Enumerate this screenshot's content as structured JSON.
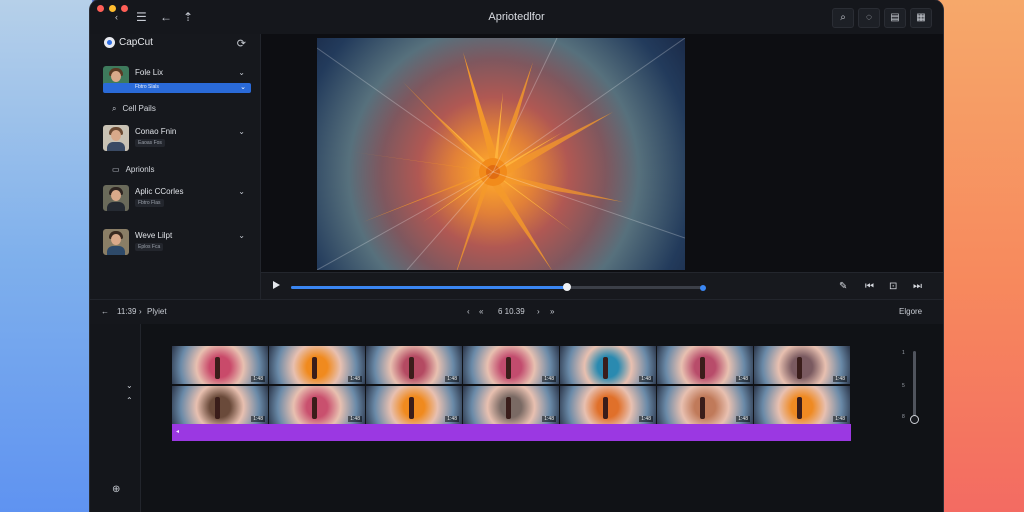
{
  "window": {
    "title": "Apriotedlfor",
    "traffic_lights": [
      "#ff5f57",
      "#febc2e",
      "#ff5f57"
    ],
    "left_icons": [
      "back-chevron-icon",
      "menu-icon",
      "arrow-back-icon",
      "share-icon"
    ],
    "right_buttons": [
      "search-icon",
      "bell-icon",
      "panel-icon",
      "layout-icon"
    ]
  },
  "sidebar": {
    "brand": "CapCut",
    "items": [
      {
        "title": "Fole Lix",
        "sub": "Fbtro Slals",
        "selected": true
      },
      {
        "title": "Cell Pails",
        "kind": "search"
      },
      {
        "title": "Conao Fnin",
        "sub": "Eaoas Fos"
      },
      {
        "title": "Aprionls",
        "kind": "plain"
      },
      {
        "title": "Aplic CCorles",
        "sub": "Fbtro Flas"
      },
      {
        "title": "Weve Lilpt",
        "sub": "Eplos Fca"
      }
    ]
  },
  "player": {
    "progress": 0.67
  },
  "timeline": {
    "time": "11:39",
    "label": "Plyiet",
    "center_time": "6 10.39",
    "right_label": "Elgore",
    "clip_badge": "1:48",
    "track_marker": "◂",
    "slider_ticks": [
      "1",
      "5",
      "8"
    ],
    "row1_hues": [
      "#c94a6a",
      "#f08a1e",
      "#b44a62",
      "#c24c6e",
      "#2a8ab0",
      "#b84c6a",
      "#7a5a60"
    ],
    "row2_hues": [
      "#6a4a3a",
      "#c9506e",
      "#f08a1e",
      "#7a6a64",
      "#e0702a",
      "#c07a5a",
      "#ef8a22"
    ]
  }
}
